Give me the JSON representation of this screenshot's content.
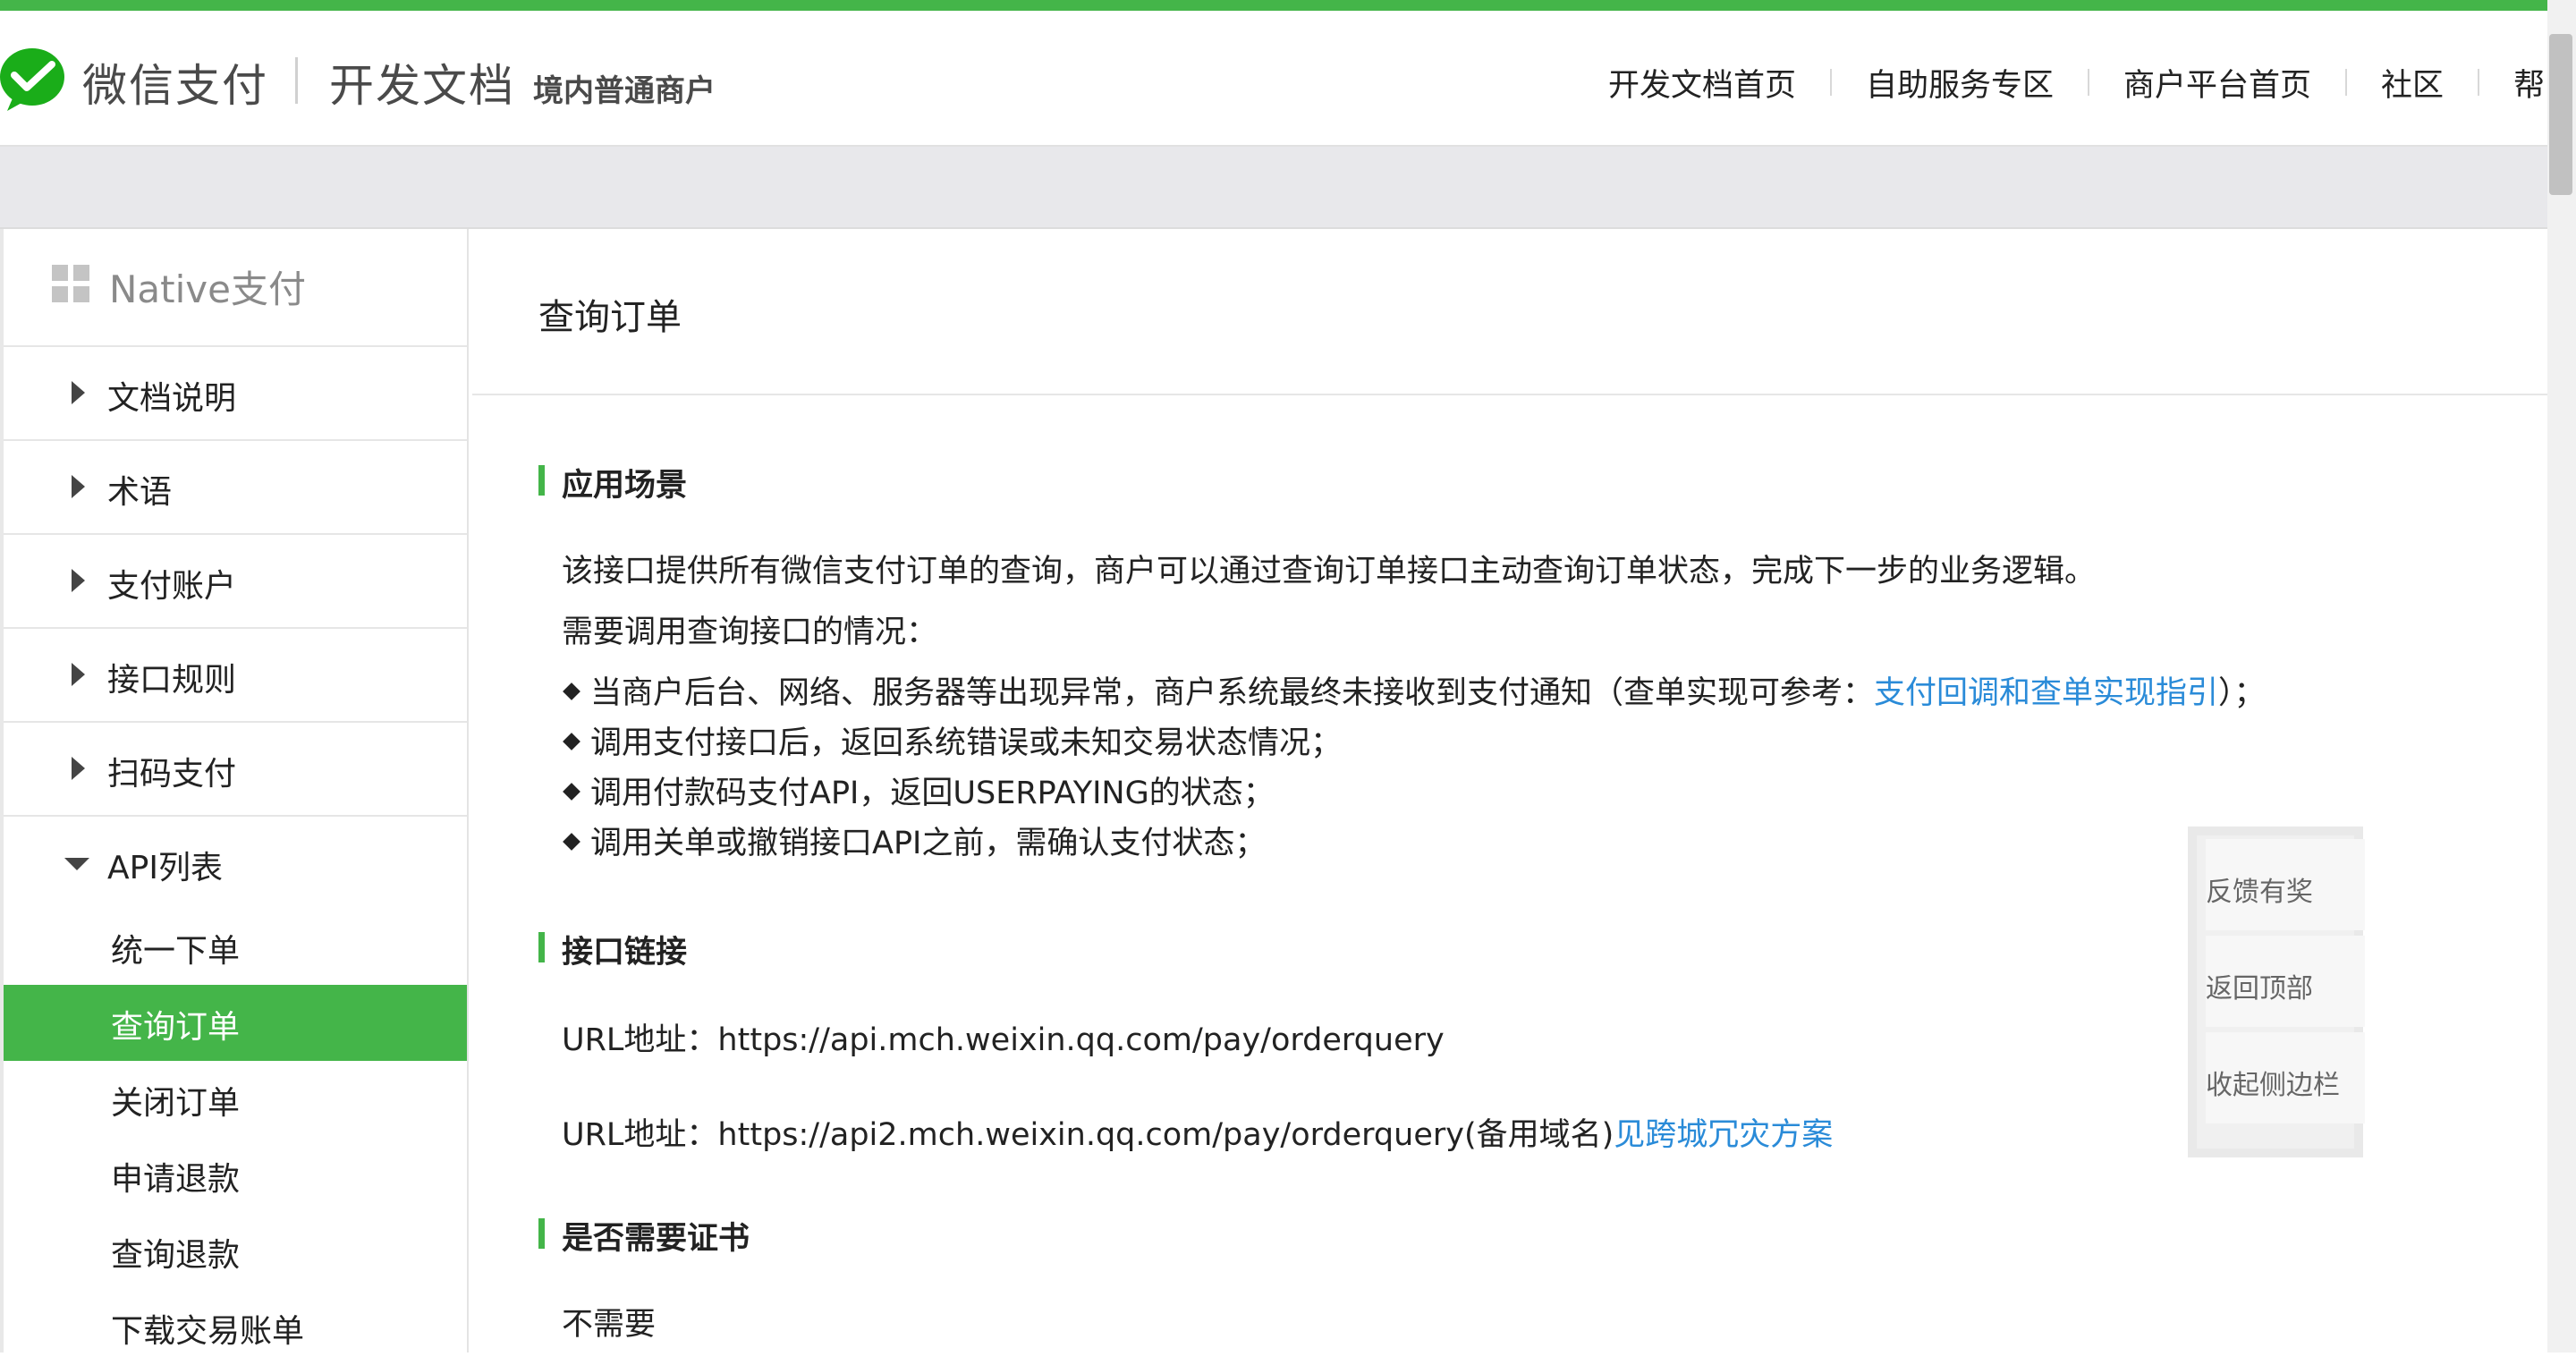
{
  "header": {
    "logo_text": "微信支付",
    "doc_title": "开发文档",
    "doc_subtitle": "境内普通商户",
    "nav": [
      "开发文档首页",
      "自助服务专区",
      "商户平台首页",
      "社区",
      "帮"
    ]
  },
  "sidebar": {
    "heading": "Native支付",
    "items": [
      "文档说明",
      "术语",
      "支付账户",
      "接口规则",
      "扫码支付"
    ],
    "open_group": "API列表",
    "sub_items": [
      "统一下单",
      "查询订单",
      "关闭订单",
      "申请退款",
      "查询退款",
      "下载交易账单"
    ],
    "active_sub": "查询订单"
  },
  "main": {
    "page_title": "查询订单",
    "sec1_title": "应用场景",
    "sec1_p1": "该接口提供所有微信支付订单的查询，商户可以通过查询订单接口主动查询订单状态，完成下一步的业务逻辑。",
    "sec1_p2": "需要调用查询接口的情况：",
    "bullet1_pre": "当商户后台、网络、服务器等出现异常，商户系统最终未接收到支付通知（查单实现可参考：",
    "bullet1_link": "支付回调和查单实现指引",
    "bullet1_post": "）；",
    "bullet2": "调用支付接口后，返回系统错误或未知交易状态情况；",
    "bullet3": "调用付款码支付API，返回USERPAYING的状态；",
    "bullet4": "调用关单或撤销接口API之前，需确认支付状态；",
    "sec2_title": "接口链接",
    "url1": "URL地址：https://api.mch.weixin.qq.com/pay/orderquery",
    "url2": "URL地址：https://api2.mch.weixin.qq.com/pay/orderquery(备用域名)",
    "url2_link": "见跨城冗灾方案",
    "sec3_title": "是否需要证书",
    "sec3_p": "不需要"
  },
  "float_panel": {
    "feedback": "反馈有奖",
    "back_top": "返回顶部",
    "collapse": "收起侧边栏"
  }
}
